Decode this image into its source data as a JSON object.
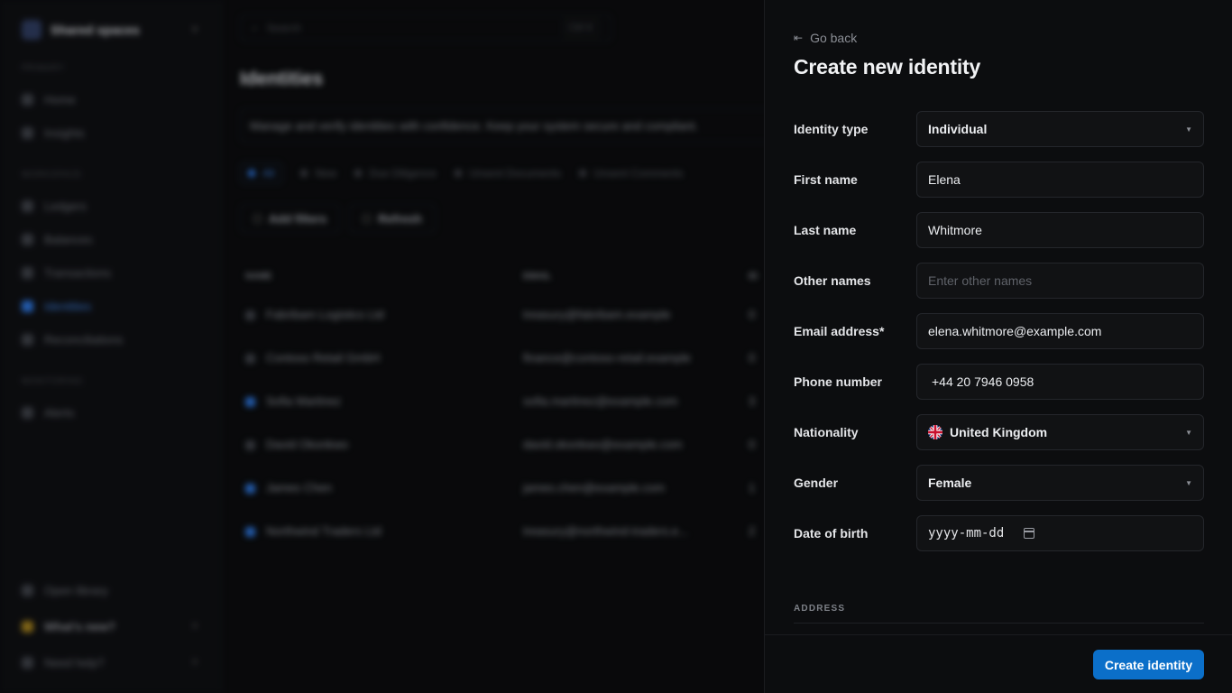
{
  "background": {
    "workspace": {
      "name": "Shared spaces"
    },
    "sidebar": {
      "sections": [
        {
          "label": "PRIMARY",
          "items": [
            "Home",
            "Insights"
          ]
        },
        {
          "label": "WORKSPACE",
          "items": [
            "Ledgers",
            "Balances",
            "Transactions",
            "Identities",
            "Reconciliations"
          ]
        },
        {
          "label": "MONITORING",
          "items": [
            "Alerts"
          ]
        }
      ],
      "active_item": "Identities",
      "bottom": [
        "Open library",
        "What's new?",
        "Need help?"
      ]
    },
    "search": {
      "placeholder": "Search",
      "shortcut": "Ctrl K"
    },
    "page_title": "Identities",
    "description": "Manage and verify identities with confidence. Keep your system secure and compliant.",
    "tabs": [
      "All",
      "New",
      "Due Diligence",
      "Unsent Documents",
      "Unsent Comments"
    ],
    "actions": [
      "Add filters",
      "Refresh"
    ],
    "table": {
      "columns": [
        "NAME",
        "EMAIL",
        "ID"
      ],
      "rows": [
        {
          "name": "Fabribam Logistics Ltd",
          "email": "treasury@fabribam.example",
          "id": "0"
        },
        {
          "name": "Contoso Retail GmbH",
          "email": "finance@contoso-retail.example",
          "id": "0"
        },
        {
          "name": "Sofia Martinez",
          "email": "sofia.martinez@example.com",
          "id": "3"
        },
        {
          "name": "David Okonkwo",
          "email": "david.okonkwo@example.com",
          "id": "0"
        },
        {
          "name": "James Chen",
          "email": "james.chen@example.com",
          "id": "1"
        },
        {
          "name": "Northwind Traders Ltd",
          "email": "treasury@northwind-traders.e...",
          "id": "2"
        }
      ]
    }
  },
  "drawer": {
    "back_label": "Go back",
    "title": "Create new identity",
    "fields": {
      "identity_type": {
        "label": "Identity type",
        "value": "Individual"
      },
      "first_name": {
        "label": "First name",
        "value": "Elena"
      },
      "last_name": {
        "label": "Last name",
        "value": "Whitmore"
      },
      "other_names": {
        "label": "Other names",
        "value": "",
        "placeholder": "Enter other names"
      },
      "email": {
        "label": "Email address*",
        "value": "elena.whitmore@example.com"
      },
      "phone": {
        "label": "Phone number",
        "value": "+44 20 7946 0958"
      },
      "nationality": {
        "label": "Nationality",
        "value": "United Kingdom"
      },
      "gender": {
        "label": "Gender",
        "value": "Female"
      },
      "dob": {
        "label": "Date of birth",
        "value": "yyyy-mm-dd"
      }
    },
    "address_section_label": "ADDRESS",
    "submit_label": "Create identity",
    "accent_color": "#0b6fc9"
  }
}
